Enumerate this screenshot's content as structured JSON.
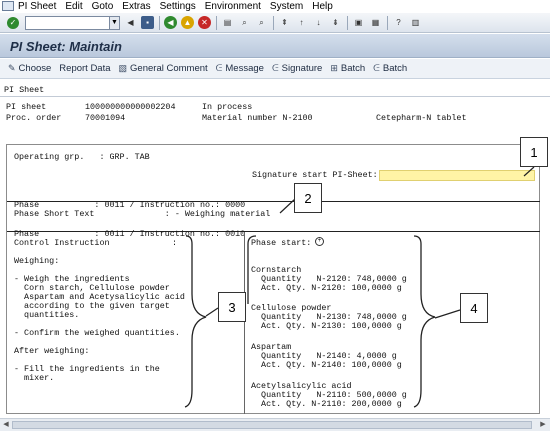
{
  "menu": [
    "PI Sheet",
    "Edit",
    "Goto",
    "Extras",
    "Settings",
    "Environment",
    "System",
    "Help"
  ],
  "title": "PI Sheet: Maintain",
  "app_toolbar": {
    "choose": "Choose",
    "report_data": "Report Data",
    "general_comment": "General Comment",
    "message": "Message",
    "signature": "Signature",
    "batch1": "Batch",
    "batch2": "Batch"
  },
  "tab": "PI Sheet",
  "header": {
    "pi_sheet_label": "PI sheet",
    "pi_sheet_value": "100000000000002204",
    "status": "In process",
    "proc_order_label": "Proc. order",
    "proc_order_value": "70001094",
    "material_label": "Material number N-2100",
    "material_desc": "Cetepharm-N tablet"
  },
  "body": {
    "operating_grp": "Operating grp.   : GRP. TAB",
    "signature_start": "Signature start PI-Sheet:",
    "phase1": "Phase           : 0011 / Instruction no.: 0000",
    "phase_short_text": "Phase Short Text              : - Weighing material",
    "phase2": "Phase           : 0011 / Instruction no.: 0010",
    "control_instruction": "Control Instruction",
    "colon": ":",
    "instructions": [
      "Weighing:",
      "",
      "- Weigh the ingredients",
      "  Corn starch, Cellulose powder",
      "  Aspartam and Acetysalicylic acid",
      "  according to the given target",
      "  quantities.",
      "",
      "- Confirm the weighed quantities.",
      "",
      "After weighing:",
      "",
      "- Fill the ingredients in the",
      "  mixer."
    ],
    "phase_start": "Phase start:",
    "materials": [
      {
        "name": "Cornstarch",
        "qty": "  Quantity   N-2120: 748,0000 g",
        "act": "  Act. Qty. N-2120: 100,0000 g"
      },
      {
        "name": "Cellulose powder",
        "qty": "  Quantity   N-2130: 748,0000 g",
        "act": "  Act. Qty. N-2130: 100,0000 g"
      },
      {
        "name": "Aspartam",
        "qty": "  Quantity   N-2140: 4,0000 g",
        "act": "  Act. Qty. N-2140: 100,0000 g"
      },
      {
        "name": "Acetylsalicylic acid",
        "qty": "  Quantity   N-2110: 500,0000 g",
        "act": "  Act. Qty. N-2110: 200,0000 g"
      }
    ]
  },
  "callouts": [
    "1",
    "2",
    "3",
    "4"
  ],
  "colors": {
    "title_bg": "#c6d3e4",
    "signature_field": "#fff4a6"
  }
}
